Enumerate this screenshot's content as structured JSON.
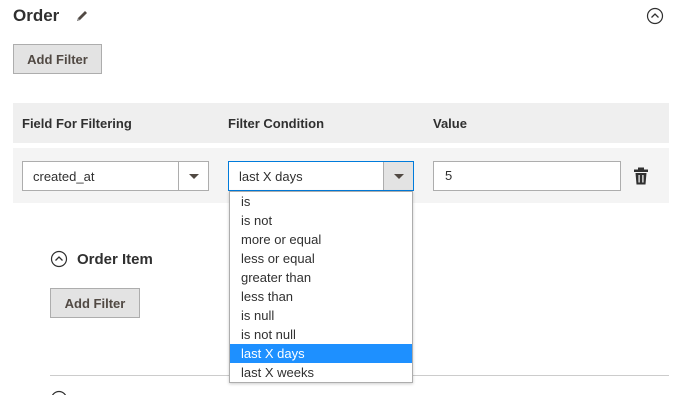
{
  "order": {
    "title": "Order",
    "add_filter_label": "Add Filter"
  },
  "filter_table": {
    "headers": [
      "Field For Filtering",
      "Filter Condition",
      "Value"
    ],
    "row": {
      "field_value": "created_at",
      "condition_value": "last X days",
      "value": "5"
    }
  },
  "condition_options": [
    "is",
    "is not",
    "more or equal",
    "less or equal",
    "greater than",
    "less than",
    "is null",
    "is not null",
    "last X days",
    "last X weeks"
  ],
  "selected_option": "last X days",
  "order_item": {
    "title": "Order Item",
    "add_filter_label": "Add Filter"
  },
  "icons": {
    "edit": "pencil-icon",
    "collapse": "collapse-circle-icon",
    "delete": "trash-icon"
  },
  "colors": {
    "selected_bg": "#1e90ff",
    "header_bg": "#efefef",
    "button_bg": "#e3e3e3"
  }
}
